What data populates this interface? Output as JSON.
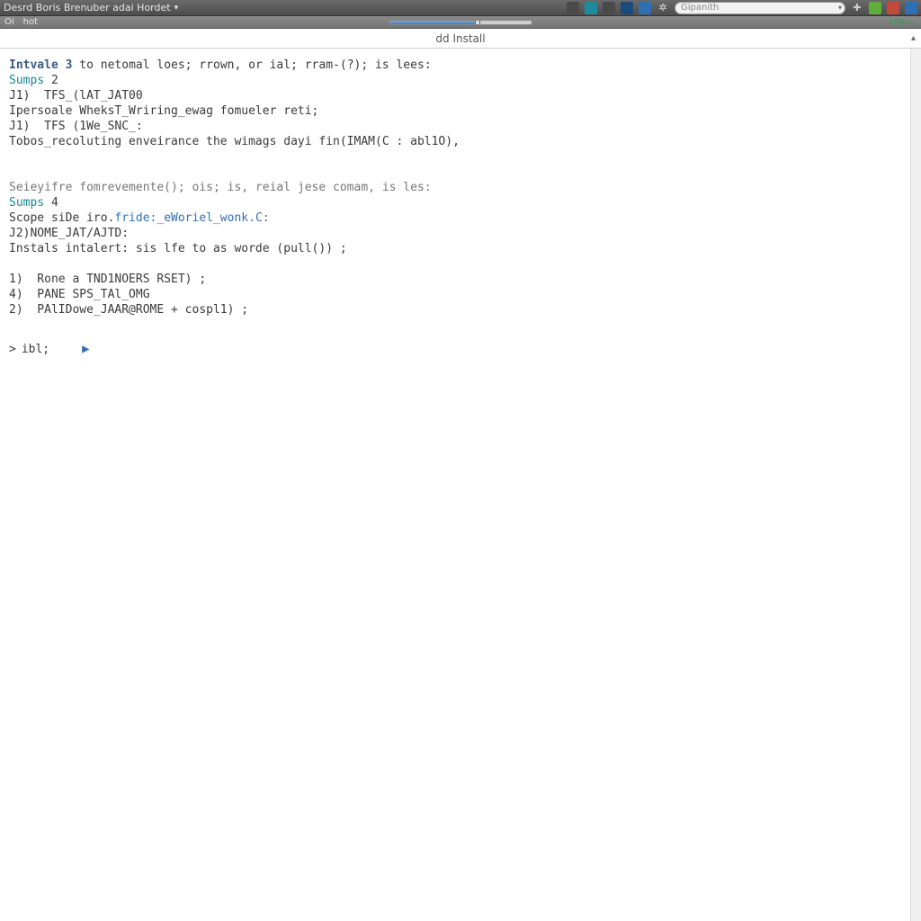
{
  "menubar": {
    "title": "Desrd Boris Brenuber adai Hordet",
    "dropdown_glyph": "▾"
  },
  "toolbar2": {
    "items": [
      "Oi",
      "hot"
    ],
    "right_text": "10N —"
  },
  "tray": {
    "search_placeholder": "Gipanith",
    "clock_text": "",
    "plus_glyph": "✚"
  },
  "tab": {
    "label": "dd Install"
  },
  "terminal": {
    "block1": {
      "hdr_pre": "Intvale ",
      "hdr_num": "3",
      "hdr_post": " to netomal loes; rrown, or ial; rram-(?); is lees:",
      "steps_label": "Sumps",
      "steps_num": "2",
      "l1": "J1)  TFS_(lAT_JAT00",
      "l2": "Ipersoale WheksT_Wriring_ewag fomueler reti;",
      "l3": "J1)  TFS (1We_SNC_:",
      "l4": "Tobos_recoluting enveirance the wimags dayi fin(IMAM(C : abl1O),"
    },
    "block2": {
      "hdr": "Seieyifre fomrevemente(); ois; is, reial jese comam, is les:",
      "steps_label": "Sumps",
      "steps_num": "4",
      "l1_pre": "Scope siDe iro.",
      "l1_blue": "fride:_eWoriel_wonk.C:",
      "l2": "J2)NOME_JAT/AJTD:",
      "l3": "Instals intalert: sis lfe to as worde (pull()) ;",
      "l4": "1)  Rone a TND1NOERS RSET) ;",
      "l5": "4)  PANE SPS_TAl_OMG",
      "l6": "2)  PAlIDowe_JAAR@ROME + cospl1) ;"
    },
    "prompt": {
      "chevron": ">",
      "text": "ibl;",
      "play_glyph": "▶"
    }
  }
}
